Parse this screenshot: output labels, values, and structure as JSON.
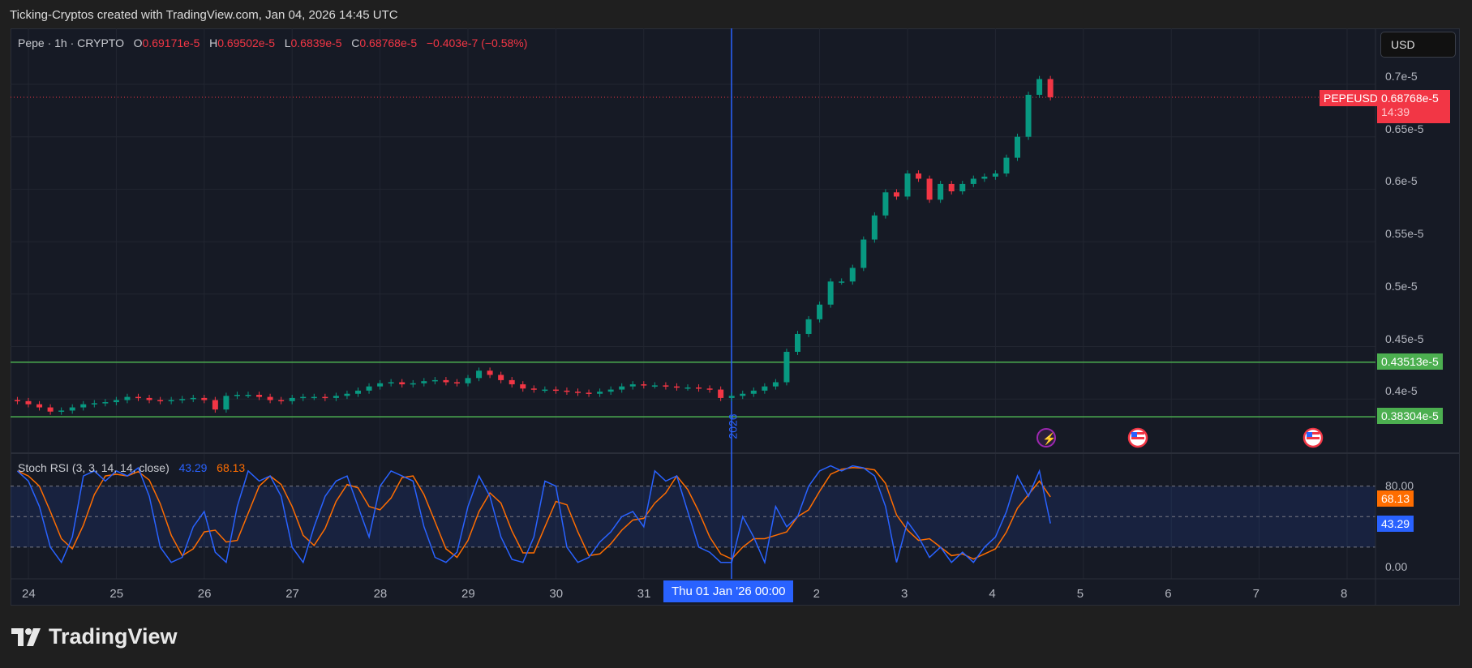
{
  "credit": "Ticking-Cryptos created with TradingView.com, Jan 04, 2026 14:45 UTC",
  "legend": {
    "symbol": "Pepe · 1h · CRYPTO",
    "o_label": "O",
    "o": "0.69171e-5",
    "h_label": "H",
    "h": "0.69502e-5",
    "l_label": "L",
    "l": "0.6839e-5",
    "c_label": "C",
    "c": "0.68768e-5",
    "change": "−0.403e-7 (−0.58%)"
  },
  "currency": "USD",
  "price_badge": {
    "ticker": "PEPEUSD",
    "price": "0.68768e-5",
    "countdown": "14:39"
  },
  "levels": [
    {
      "label": "0.43513e-5",
      "value": 0.43513
    },
    {
      "label": "0.38304e-5",
      "value": 0.38304
    }
  ],
  "rsi": {
    "title": "Stoch RSI (3, 3, 14, 14, close)",
    "k": "43.29",
    "d": "68.13",
    "k_badge": "43.29",
    "d_badge": "68.13"
  },
  "year_marker": "2026",
  "crosshair_label": "Thu 01 Jan '26   00:00",
  "logo": "TradingView",
  "colors": {
    "up": "#089981",
    "down": "#f23645",
    "level": "#4caf50",
    "k": "#2962ff",
    "d": "#ff6d00"
  },
  "chart_data": {
    "type": "candlestick",
    "title": "Pepe · 1h · CRYPTO",
    "unit": "e-5 USD",
    "y_ticks": [
      "0.7e-5",
      "0.65e-5",
      "0.6e-5",
      "0.55e-5",
      "0.5e-5",
      "0.45e-5",
      "0.4e-5"
    ],
    "y_tick_values": [
      0.7,
      0.65,
      0.6,
      0.55,
      0.5,
      0.45,
      0.4
    ],
    "x_ticks": [
      "24",
      "25",
      "26",
      "27",
      "28",
      "29",
      "30",
      "31",
      "",
      "2",
      "3",
      "4",
      "5",
      "6",
      "7",
      "8"
    ],
    "start": "Dec 23 21:00",
    "interval_hours": 3,
    "closes": [
      0.398,
      0.395,
      0.392,
      0.388,
      0.389,
      0.392,
      0.395,
      0.396,
      0.397,
      0.399,
      0.402,
      0.401,
      0.399,
      0.398,
      0.399,
      0.4,
      0.401,
      0.399,
      0.39,
      0.403,
      0.404,
      0.404,
      0.402,
      0.399,
      0.398,
      0.401,
      0.402,
      0.402,
      0.401,
      0.403,
      0.405,
      0.408,
      0.412,
      0.415,
      0.416,
      0.414,
      0.415,
      0.417,
      0.418,
      0.416,
      0.415,
      0.42,
      0.427,
      0.423,
      0.418,
      0.414,
      0.41,
      0.409,
      0.409,
      0.408,
      0.407,
      0.406,
      0.405,
      0.407,
      0.409,
      0.412,
      0.414,
      0.413,
      0.413,
      0.412,
      0.411,
      0.411,
      0.41,
      0.409,
      0.401,
      0.403,
      0.405,
      0.408,
      0.412,
      0.416,
      0.445,
      0.462,
      0.476,
      0.49,
      0.512,
      0.512,
      0.525,
      0.552,
      0.575,
      0.597,
      0.593,
      0.615,
      0.61,
      0.59,
      0.605,
      0.598,
      0.605,
      0.61,
      0.612,
      0.615,
      0.63,
      0.65,
      0.69,
      0.705,
      0.68768
    ],
    "stoch_rsi": {
      "y_ticks": [
        "80.00",
        "0.00"
      ],
      "y_tick_values": [
        80,
        0
      ],
      "bands": [
        80,
        50,
        20
      ],
      "k": [
        95,
        85,
        60,
        20,
        5,
        30,
        90,
        95,
        85,
        95,
        90,
        98,
        70,
        20,
        5,
        10,
        40,
        55,
        15,
        5,
        60,
        95,
        85,
        90,
        70,
        20,
        5,
        40,
        70,
        85,
        90,
        60,
        30,
        80,
        95,
        90,
        85,
        40,
        10,
        5,
        15,
        60,
        90,
        70,
        30,
        8,
        5,
        30,
        85,
        80,
        20,
        5,
        10,
        25,
        35,
        50,
        55,
        40,
        95,
        85,
        90,
        55,
        20,
        15,
        5,
        5,
        50,
        30,
        5,
        60,
        40,
        50,
        80,
        95,
        100,
        95,
        100,
        98,
        90,
        60,
        5,
        45,
        30,
        10,
        20,
        5,
        15,
        5,
        20,
        30,
        55,
        90,
        70,
        95,
        43.29
      ]
    }
  }
}
